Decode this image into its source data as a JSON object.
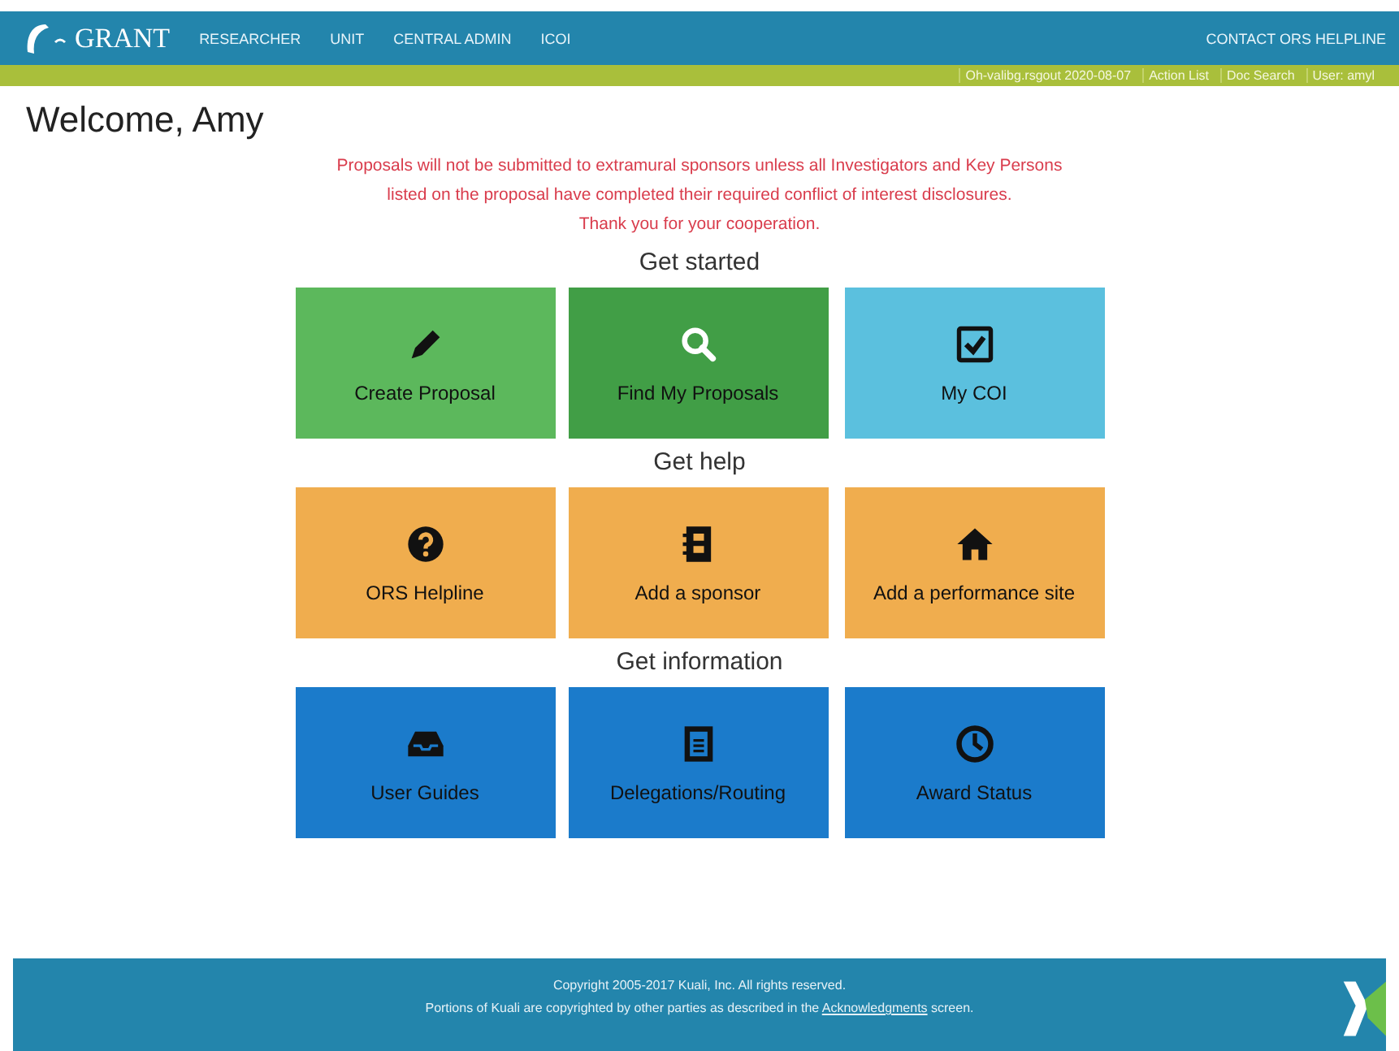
{
  "header": {
    "logo_text": "GRANT",
    "nav": [
      "RESEARCHER",
      "UNIT",
      "CENTRAL ADMIN",
      "ICOI"
    ],
    "contact": "CONTACT ORS HELPLINE"
  },
  "subbar": {
    "items": [
      "Oh-valibg.rsgout 2020-08-07",
      "Action List",
      "Doc Search",
      "User: amyl"
    ]
  },
  "welcome": "Welcome, Amy",
  "notice": [
    "Proposals will not be submitted to extramural sponsors unless all Investigators and Key Persons",
    "listed on the proposal have completed their required conflict of interest disclosures.",
    "Thank you for your cooperation."
  ],
  "sections": [
    {
      "title": "Get started",
      "tiles": [
        {
          "label": "Create Proposal",
          "kind": "pencil",
          "color": "#5cb85c"
        },
        {
          "label": "Find My Proposals",
          "kind": "search",
          "color": "#419e46"
        },
        {
          "label": "My COI",
          "kind": "checkbox",
          "color": "#5bc0de"
        }
      ]
    },
    {
      "title": "Get help",
      "tiles": [
        {
          "label": "ORS Helpline",
          "kind": "question",
          "color": "#f0ad4e"
        },
        {
          "label": "Add a sponsor",
          "kind": "book",
          "color": "#f0ad4e"
        },
        {
          "label": "Add a performance site",
          "kind": "home",
          "color": "#f0ad4e"
        }
      ]
    },
    {
      "title": "Get information",
      "tiles": [
        {
          "label": "User Guides",
          "kind": "inbox",
          "color": "#1b7bcb"
        },
        {
          "label": "Delegations/Routing",
          "kind": "document",
          "color": "#1b7bcb"
        },
        {
          "label": "Award Status",
          "kind": "clock",
          "color": "#1b7bcb"
        }
      ]
    }
  ],
  "footer": {
    "copyright": "Copyright 2005-2017 Kuali, Inc. All rights reserved.",
    "portions_before": "Portions of Kuali are copyrighted by other parties as described in the",
    "link": "Acknowledgments",
    "portions_after": "screen."
  }
}
